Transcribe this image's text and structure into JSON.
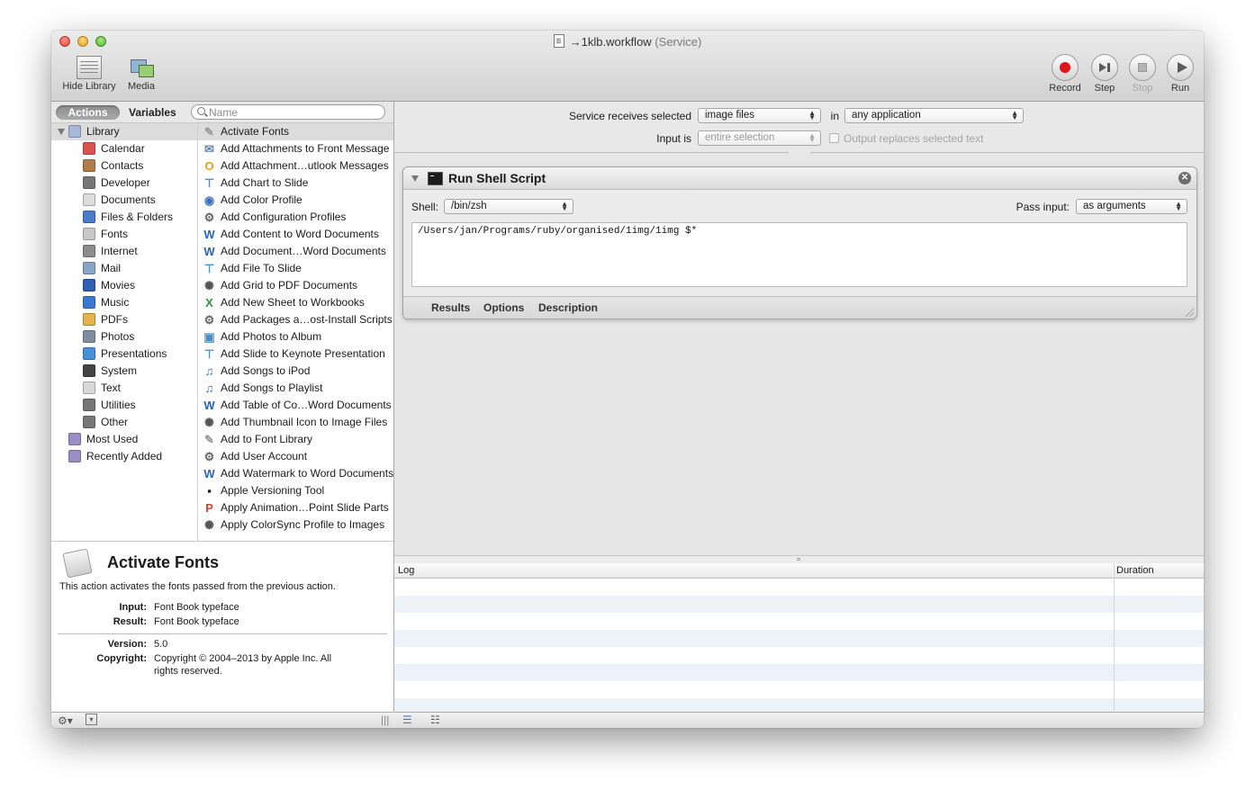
{
  "window": {
    "title": "→1klb.workflow",
    "subtitle": "(Service)"
  },
  "toolbar": {
    "hide_library": "Hide Library",
    "media": "Media",
    "record": "Record",
    "step": "Step",
    "stop": "Stop",
    "run": "Run"
  },
  "library": {
    "tabs": {
      "actions": "Actions",
      "variables": "Variables"
    },
    "search_placeholder": "Name",
    "categories": [
      {
        "label": "Library",
        "icon": "library-icon",
        "color": "#a9b8d8"
      },
      {
        "label": "Calendar",
        "icon": "calendar-icon",
        "color": "#d9534f"
      },
      {
        "label": "Contacts",
        "icon": "contacts-icon",
        "color": "#b07d4a"
      },
      {
        "label": "Developer",
        "icon": "tools-icon",
        "color": "#777777"
      },
      {
        "label": "Documents",
        "icon": "document-icon",
        "color": "#dcdcdc"
      },
      {
        "label": "Files & Folders",
        "icon": "finder-icon",
        "color": "#4a7cc9"
      },
      {
        "label": "Fonts",
        "icon": "font-icon",
        "color": "#c8c8c8"
      },
      {
        "label": "Internet",
        "icon": "globe-icon",
        "color": "#8c8c8c"
      },
      {
        "label": "Mail",
        "icon": "mail-icon",
        "color": "#8aa3c8"
      },
      {
        "label": "Movies",
        "icon": "movies-icon",
        "color": "#2f5fb3"
      },
      {
        "label": "Music",
        "icon": "music-icon",
        "color": "#3b78d4"
      },
      {
        "label": "PDFs",
        "icon": "pdf-icon",
        "color": "#e3b34c"
      },
      {
        "label": "Photos",
        "icon": "photos-icon",
        "color": "#7f8f9f"
      },
      {
        "label": "Presentations",
        "icon": "presentation-icon",
        "color": "#4a90d9"
      },
      {
        "label": "System",
        "icon": "system-icon",
        "color": "#444444"
      },
      {
        "label": "Text",
        "icon": "text-icon",
        "color": "#d8d8d8"
      },
      {
        "label": "Utilities",
        "icon": "tools-icon",
        "color": "#777777"
      },
      {
        "label": "Other",
        "icon": "tools-icon",
        "color": "#777777"
      },
      {
        "label": "Most Used",
        "icon": "smart-folder-icon",
        "color": "#9a8fc4"
      },
      {
        "label": "Recently Added",
        "icon": "smart-folder-icon",
        "color": "#9a8fc4"
      }
    ],
    "actions": [
      {
        "label": "Activate Fonts",
        "icon": "font-icon",
        "glyph": "✎",
        "color": "#9a9a9a"
      },
      {
        "label": "Add Attachments to Front Message",
        "icon": "mail-icon",
        "glyph": "✉",
        "color": "#6d86a8"
      },
      {
        "label": "Add Attachment…utlook Messages",
        "icon": "outlook-icon",
        "glyph": "O",
        "color": "#e0a020"
      },
      {
        "label": "Add Chart to Slide",
        "icon": "keynote-icon",
        "glyph": "⊤",
        "color": "#4a90d9"
      },
      {
        "label": "Add Color Profile",
        "icon": "colorsync-icon",
        "glyph": "◉",
        "color": "#3a6fc0"
      },
      {
        "label": "Add Configuration Profiles",
        "icon": "automator-icon",
        "glyph": "⚙",
        "color": "#666666"
      },
      {
        "label": "Add Content to Word Documents",
        "icon": "word-icon",
        "glyph": "W",
        "color": "#2a62b8"
      },
      {
        "label": "Add Document…Word Documents",
        "icon": "word-icon",
        "glyph": "W",
        "color": "#2a62b8"
      },
      {
        "label": "Add File To Slide",
        "icon": "keynote-icon",
        "glyph": "⊤",
        "color": "#4a90d9"
      },
      {
        "label": "Add Grid to PDF Documents",
        "icon": "preview-icon",
        "glyph": "✺",
        "color": "#555555"
      },
      {
        "label": "Add New Sheet to Workbooks",
        "icon": "excel-icon",
        "glyph": "X",
        "color": "#2f8f3a"
      },
      {
        "label": "Add Packages a…ost-Install Scripts",
        "icon": "automator-icon",
        "glyph": "⚙",
        "color": "#666666"
      },
      {
        "label": "Add Photos to Album",
        "icon": "iphoto-icon",
        "glyph": "▣",
        "color": "#4b8bbf"
      },
      {
        "label": "Add Slide to Keynote Presentation",
        "icon": "keynote-icon",
        "glyph": "⊤",
        "color": "#4a90d9"
      },
      {
        "label": "Add Songs to iPod",
        "icon": "itunes-icon",
        "glyph": "♫",
        "color": "#2f6fd0"
      },
      {
        "label": "Add Songs to Playlist",
        "icon": "itunes-icon",
        "glyph": "♫",
        "color": "#2f6fd0"
      },
      {
        "label": "Add Table of Co…Word Documents",
        "icon": "word-icon",
        "glyph": "W",
        "color": "#2a62b8"
      },
      {
        "label": "Add Thumbnail Icon to Image Files",
        "icon": "preview-icon",
        "glyph": "✺",
        "color": "#555555"
      },
      {
        "label": "Add to Font Library",
        "icon": "font-icon",
        "glyph": "✎",
        "color": "#9a9a9a"
      },
      {
        "label": "Add User Account",
        "icon": "automator-icon",
        "glyph": "⚙",
        "color": "#666666"
      },
      {
        "label": "Add Watermark to Word Documents",
        "icon": "word-icon",
        "glyph": "W",
        "color": "#2a62b8"
      },
      {
        "label": "Apple Versioning Tool",
        "icon": "terminal-icon",
        "glyph": "▪",
        "color": "#1b1b1b"
      },
      {
        "label": "Apply Animation…Point Slide Parts",
        "icon": "powerpoint-icon",
        "glyph": "P",
        "color": "#d2462a"
      },
      {
        "label": "Apply ColorSync Profile to Images",
        "icon": "preview-icon",
        "glyph": "✺",
        "color": "#555555"
      }
    ]
  },
  "description": {
    "title": "Activate Fonts",
    "text": "This action activates the fonts passed from the previous action.",
    "input_label": "Input:",
    "input_value": "Font Book typeface",
    "result_label": "Result:",
    "result_value": "Font Book typeface",
    "version_label": "Version:",
    "version_value": "5.0",
    "copyright_label": "Copyright:",
    "copyright_line1": "Copyright © 2004–2013 by Apple Inc. All",
    "copyright_line2": "rights reserved."
  },
  "service": {
    "receives_label": "Service receives selected",
    "receives_value": "image files",
    "in_label": "in",
    "app_value": "any application",
    "input_is_label": "Input is",
    "input_is_value": "entire selection",
    "output_replaces_label": "Output replaces selected text"
  },
  "action": {
    "title": "Run Shell Script",
    "shell_label": "Shell:",
    "shell_value": "/bin/zsh",
    "pass_input_label": "Pass input:",
    "pass_input_value": "as arguments",
    "script": "/Users/jan/Programs/ruby/organised/1img/1img $*",
    "tabs": [
      "Results",
      "Options",
      "Description"
    ]
  },
  "log": {
    "col_log": "Log",
    "col_duration": "Duration"
  }
}
